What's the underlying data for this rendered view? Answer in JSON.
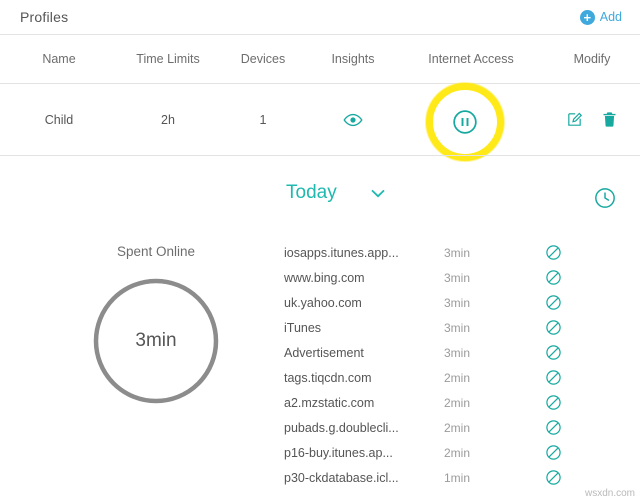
{
  "header": {
    "title": "Profiles",
    "add_label": "Add",
    "add_icon": "plus-circle-icon",
    "accent": "#3fa9dd"
  },
  "table": {
    "columns": [
      "Name",
      "Time Limits",
      "Devices",
      "Insights",
      "Internet Access",
      "Modify"
    ],
    "rows": [
      {
        "name": "Child",
        "time_limits": "2h",
        "devices": "1",
        "insights_icon": "eye-icon",
        "internet_access_icon": "pause-circle-icon",
        "modify_icons": [
          "edit-icon",
          "trash-icon"
        ]
      }
    ],
    "accent": "#17a9a0",
    "highlight_color": "#ffe919"
  },
  "today": {
    "label": "Today",
    "chevron_icon": "chevron-down-icon",
    "history_icon": "clock-history-icon",
    "accent": "#1fb9b0"
  },
  "spent_online": {
    "label": "Spent Online",
    "value": "3min",
    "ring_color": "#8c8c8c"
  },
  "sites": {
    "block_icon": "block-icon",
    "items": [
      {
        "name": "iosapps.itunes.app...",
        "time": "3min"
      },
      {
        "name": "www.bing.com",
        "time": "3min"
      },
      {
        "name": "uk.yahoo.com",
        "time": "3min"
      },
      {
        "name": "iTunes",
        "time": "3min"
      },
      {
        "name": "Advertisement",
        "time": "3min"
      },
      {
        "name": "tags.tiqcdn.com",
        "time": "2min"
      },
      {
        "name": "a2.mzstatic.com",
        "time": "2min"
      },
      {
        "name": "pubads.g.doublecli...",
        "time": "2min"
      },
      {
        "name": "p16-buy.itunes.ap...",
        "time": "2min"
      },
      {
        "name": "p30-ckdatabase.icl...",
        "time": "1min"
      }
    ]
  },
  "watermark": "wsxdn.com"
}
